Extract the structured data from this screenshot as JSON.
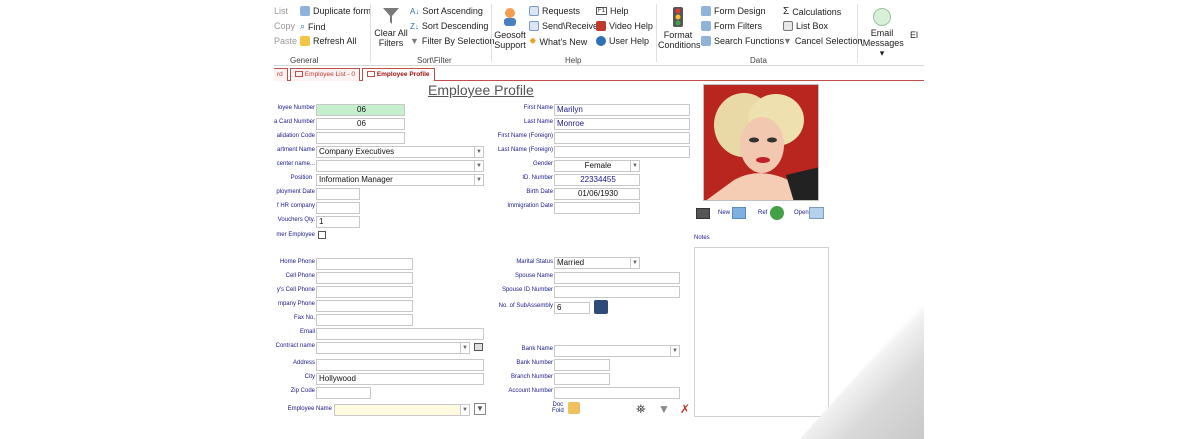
{
  "ribbon": {
    "list": "List",
    "copy": "Copy",
    "paste": "Paste",
    "duplicate_form": "Duplicate form",
    "find": "Find",
    "refresh_all": "Refresh All",
    "general": "General",
    "clear_all_filters_1": "Clear All",
    "clear_all_filters_2": "Filters",
    "sort_ascending": "Sort  Ascending",
    "sort_descending": "Sort Descending",
    "filter_by_selection": "Filter By Selection",
    "sort_filter": "Sort\\Filter",
    "geosoft_support_1": "Geosoft",
    "geosoft_support_2": "Support",
    "requests": "Requests",
    "send_receive": "Send\\Receive",
    "whats_new": "What's New",
    "f1_help": "Help",
    "video_help": "Video Help",
    "user_help": "User Help",
    "help": "Help",
    "format_conditions_1": "Format",
    "format_conditions_2": "Conditions",
    "form_design": "Form Design",
    "form_filters": "Form Filters",
    "search_functions": "Search Functions",
    "calculations": "Calculations",
    "list_box": "List Box",
    "cancel_selection": "Cancel Selection",
    "data": "Data",
    "email_messages_1": "Email",
    "email_messages_2": "\\Messages",
    "el": "El"
  },
  "tabs": [
    "rd",
    "Employee List - 0",
    "Employee Profile"
  ],
  "form": {
    "title": "Employee Profile",
    "left": {
      "employee_number_label": "loyee Number",
      "employee_number": "06",
      "card_number_label": "a Card Number",
      "card_number": "06",
      "validation_code_label": "alidation Code",
      "department_name_label": "artment Name",
      "department_name": "Company Executives",
      "center_name_label": "center name...",
      "position_label": "Position",
      "position": "Information Manager",
      "employment_date_label": "ployment Date",
      "hr_company_label": "f HR company",
      "vouchers_qty_label": "Vouchers Qty.",
      "vouchers_qty": "1",
      "former_employee_label": "mer Employee",
      "home_phone_label": "Home Phone",
      "cell_phone_label": "Cell Phone",
      "cell_phone2_label": "y's Cell Phone",
      "company_phone_label": "mpany Phone",
      "fax_label": "Fax No.",
      "email_label": "Email",
      "contract_name_label": "Contract name",
      "address_label": "Address",
      "city_label": "City",
      "city": "Hollywood",
      "zip_label": "Zip Code",
      "employee_name_label": "Employee Name"
    },
    "right": {
      "first_name_label": "First Name",
      "first_name": "Marilyn",
      "last_name_label": "Last Name",
      "last_name": "Monroe",
      "first_name_foreign_label": "First Name (Foreign)",
      "last_name_foreign_label": "Last Name (Foreign)",
      "gender_label": "Gender",
      "gender": "Female",
      "id_number_label": "ID. Number",
      "id_number": "22334455",
      "birth_date_label": "Birth Date",
      "birth_date": "01/06/1930",
      "immigration_date_label": "Immigration Date",
      "marital_status_label": "Marital Status",
      "marital_status": "Married",
      "spouse_name_label": "Spouse Name",
      "spouse_id_label": "Spouse ID Number",
      "subassembly_label": "No. of SubAssembly",
      "subassembly": "6",
      "bank_name_label": "Bank Name",
      "bank_number_label": "Bank Number",
      "branch_number_label": "Branch Number",
      "account_number_label": "Account Number",
      "doc_fold_1": "Doc",
      "doc_fold_2": "Fold"
    },
    "photo": {
      "new": "New",
      "ref": "Ref",
      "open": "Open",
      "notes": "Notes"
    }
  },
  "colors": {
    "accent": "#c0504d",
    "label": "#1a1a8a",
    "green_field": "#c6efce"
  }
}
